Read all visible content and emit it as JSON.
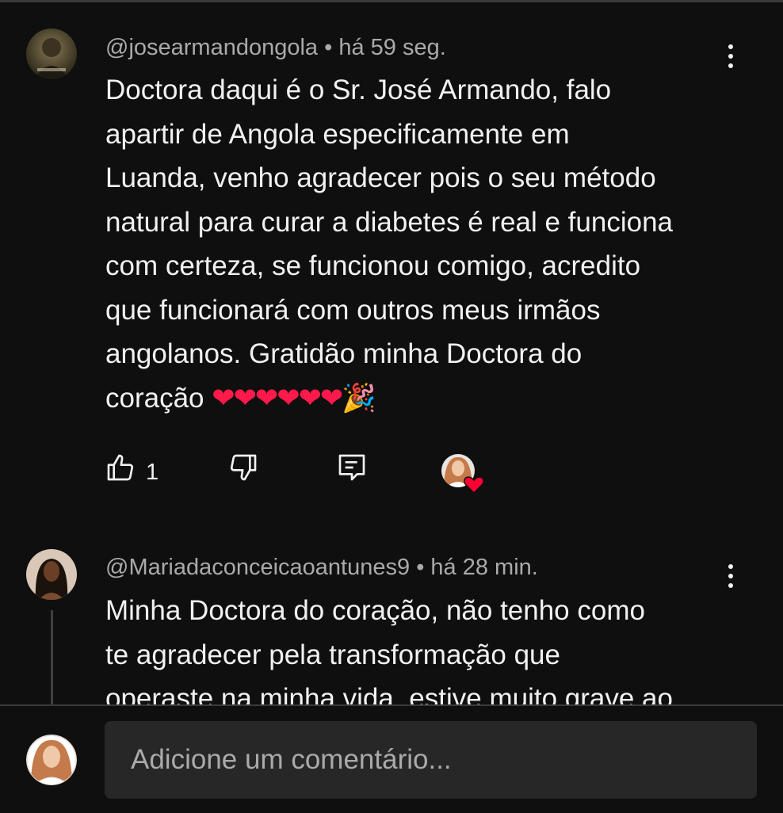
{
  "comments": [
    {
      "author": "@josearmandongola",
      "separator": "•",
      "time": "há 59 seg.",
      "lines": [
        "Doctora daqui é o Sr. José Armando, falo",
        "apartir de Angola especificamente em",
        "Luanda, venho agradecer pois o seu método",
        "natural para curar a diabetes é real e funciona",
        "com certeza, se funcionou comigo, acredito",
        "que funcionará com outros meus irmãos",
        "angolanos. Gratidão minha Doctora do"
      ],
      "last_line": "coração",
      "emoji_hearts": "❤❤❤❤❤❤",
      "emoji_party": "🎉",
      "like_count": "1",
      "icons": [
        "like-icon",
        "dislike-icon",
        "reply-icon",
        "creator-heart-icon",
        "more-vert-icon"
      ]
    },
    {
      "author": "@Mariadaconceicaoantunes9",
      "separator": "•",
      "time": "há 28 min.",
      "lines": [
        "Minha Doctora do coração, não tenho como",
        "te agradecer pela transformação que",
        "operaste na minha vida, estive muito grave ao"
      ]
    }
  ],
  "composer": {
    "placeholder": "Adicione um comentário..."
  },
  "colors": {
    "background": "#0f0f0f",
    "text": "#f1f1f1",
    "meta": "#aaaaaa",
    "input_bg": "#272727",
    "heart": "#ff1a4b"
  }
}
